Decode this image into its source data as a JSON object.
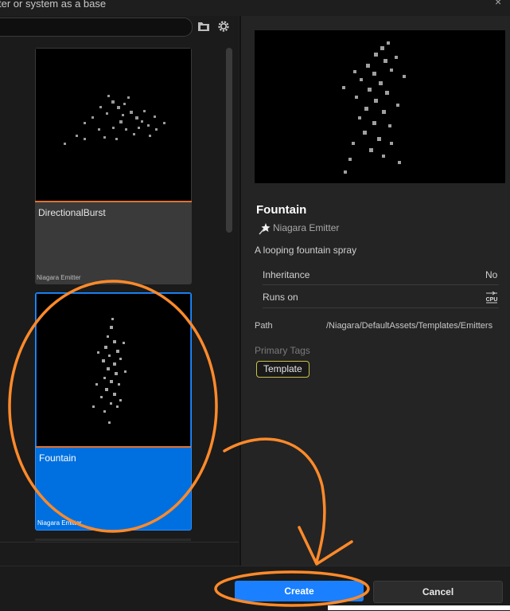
{
  "header": {
    "title": "ter or system as a base",
    "close_glyph": "×"
  },
  "toolbar": {
    "folder_icon": "folder-icon",
    "settings_icon": "gear-icon"
  },
  "cards": [
    {
      "name": "DirectionalBurst",
      "type": "Niagara Emitter",
      "selected": false
    },
    {
      "name": "Fountain",
      "type": "Niagara Emitter",
      "selected": true
    }
  ],
  "details": {
    "title": "Fountain",
    "type_label": "Niagara Emitter",
    "description": "A looping fountain spray",
    "inheritance_label": "Inheritance",
    "inheritance_value": "No",
    "runs_on_label": "Runs on",
    "runs_on_value": "CPU",
    "path_label": "Path",
    "path_value": "/Niagara/DefaultAssets/Templates/Emitters",
    "primary_tags_label": "Primary Tags",
    "tag": "Template"
  },
  "buttons": {
    "create": "Create",
    "cancel": "Cancel"
  },
  "colors": {
    "accent_blue": "#0070e0",
    "create_blue": "#1a80ff",
    "thumb_underline": "#e2712d",
    "annotation_orange": "#ff8a2a",
    "tag_border": "#c9c24a"
  }
}
